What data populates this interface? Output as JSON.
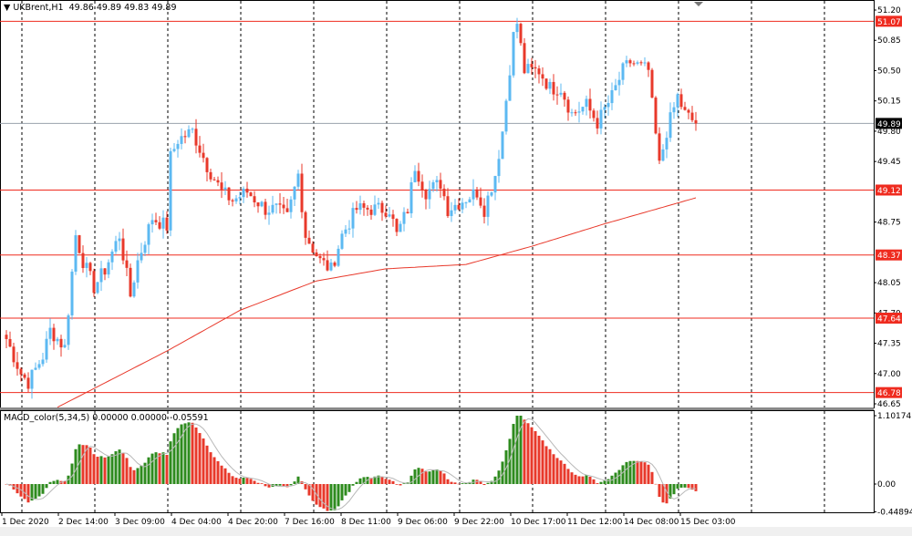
{
  "header": {
    "symbol": "UKBrent,H1",
    "open": "49.86",
    "high": "49.89",
    "low": "49.83",
    "close": "49.89"
  },
  "macd": {
    "label": "MACD_color(5,34,5)",
    "v1": "0.00000",
    "v2": "0.00000",
    "v3": "-0.05591"
  },
  "colors": {
    "up": "#5cb9f2",
    "down": "#e8392b",
    "level": "#ef2b1f",
    "ma": "#e8392b",
    "macd_up": "#2e8b1e",
    "macd_down": "#e8392b"
  },
  "chart_data": {
    "type": "candlestick",
    "price_ticks": [
      "51.20",
      "50.85",
      "50.50",
      "50.15",
      "49.80",
      "49.45",
      "48.75",
      "48.05",
      "47.70",
      "47.35",
      "47.00",
      "46.65"
    ],
    "price_range": [
      46.65,
      51.2
    ],
    "level_labels": [
      "51.07",
      "49.12",
      "48.37",
      "47.64",
      "46.78"
    ],
    "current_price": "49.89",
    "macd_ticks": [
      "1.10174",
      "0.00",
      "-0.44894"
    ],
    "macd_range": [
      -0.44894,
      1.10174
    ],
    "time_labels": [
      "1 Dec 2020",
      "2 Dec 14:00",
      "3 Dec 09:00",
      "4 Dec 04:00",
      "4 Dec 20:00",
      "7 Dec 16:00",
      "8 Dec 11:00",
      "9 Dec 06:00",
      "9 Dec 22:00",
      "10 Dec 17:00",
      "11 Dec 12:00",
      "14 Dec 08:00",
      "15 Dec 03:00"
    ],
    "bar_count": 190,
    "close_keypoints": [
      [
        0,
        47.4
      ],
      [
        4,
        47.0
      ],
      [
        6,
        46.9
      ],
      [
        10,
        47.2
      ],
      [
        12,
        47.5
      ],
      [
        16,
        47.3
      ],
      [
        19,
        48.6
      ],
      [
        21,
        48.3
      ],
      [
        24,
        48.0
      ],
      [
        27,
        48.2
      ],
      [
        31,
        48.6
      ],
      [
        34,
        47.9
      ],
      [
        36,
        48.3
      ],
      [
        40,
        48.8
      ],
      [
        44,
        48.7
      ],
      [
        45,
        49.5
      ],
      [
        47,
        49.7
      ],
      [
        51,
        49.8
      ],
      [
        55,
        49.4
      ],
      [
        59,
        49.1
      ],
      [
        62,
        49.0
      ],
      [
        66,
        49.1
      ],
      [
        71,
        48.9
      ],
      [
        74,
        48.9
      ],
      [
        77,
        48.8
      ],
      [
        80,
        49.3
      ],
      [
        82,
        48.6
      ],
      [
        86,
        48.3
      ],
      [
        89,
        48.2
      ],
      [
        92,
        48.6
      ],
      [
        96,
        48.9
      ],
      [
        101,
        48.9
      ],
      [
        105,
        48.9
      ],
      [
        107,
        48.6
      ],
      [
        110,
        48.9
      ],
      [
        112,
        49.4
      ],
      [
        115,
        49.1
      ],
      [
        119,
        49.2
      ],
      [
        121,
        48.9
      ],
      [
        125,
        49.0
      ],
      [
        129,
        49.1
      ],
      [
        131,
        48.9
      ],
      [
        134,
        49.3
      ],
      [
        136,
        49.8
      ],
      [
        139,
        50.9
      ],
      [
        140,
        51.05
      ],
      [
        142,
        50.5
      ],
      [
        146,
        50.5
      ],
      [
        149,
        50.3
      ],
      [
        152,
        50.3
      ],
      [
        155,
        50.0
      ],
      [
        159,
        50.1
      ],
      [
        162,
        49.9
      ],
      [
        166,
        50.2
      ],
      [
        169,
        50.5
      ],
      [
        171,
        50.6
      ],
      [
        176,
        50.5
      ],
      [
        177,
        50.1
      ],
      [
        179,
        49.4
      ],
      [
        181,
        49.8
      ],
      [
        184,
        50.2
      ],
      [
        186,
        50.0
      ],
      [
        189,
        49.89
      ]
    ],
    "ma_keypoints": [
      [
        14,
        46.61
      ],
      [
        44,
        47.26
      ],
      [
        64,
        47.73
      ],
      [
        85,
        48.07
      ],
      [
        104,
        48.21
      ],
      [
        126,
        48.26
      ],
      [
        144,
        48.47
      ],
      [
        164,
        48.73
      ],
      [
        189,
        49.03
      ]
    ]
  }
}
